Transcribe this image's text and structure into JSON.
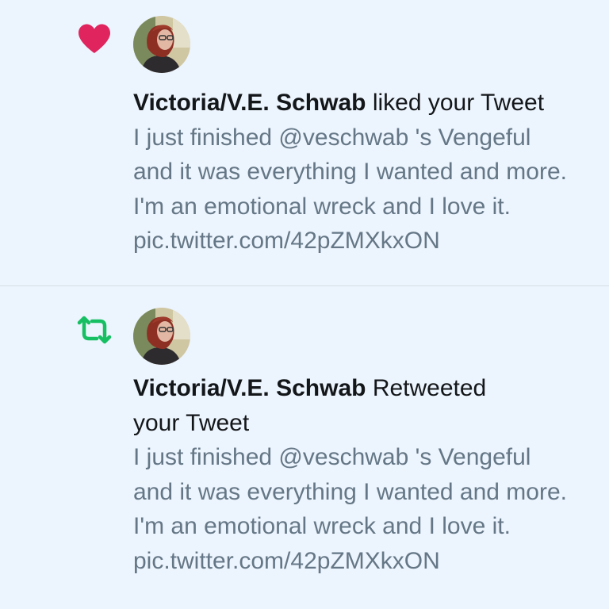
{
  "notifications": [
    {
      "type": "like",
      "icon": "heart-icon",
      "icon_color": "#e0245e",
      "user_name": "Victoria/V.E. Schwab",
      "action": "liked your Tweet",
      "tweet_text": "I just finished @veschwab 's Vengeful\nand it was everything I wanted and more.\nI'm an emotional wreck and I love it.\npic.twitter.com/42pZMXkxON"
    },
    {
      "type": "retweet",
      "icon": "retweet-icon",
      "icon_color": "#17bf63",
      "user_name": "Victoria/V.E. Schwab",
      "action": "Retweeted\nyour Tweet",
      "tweet_text": "I just finished @veschwab 's Vengeful\nand it was everything I wanted and more.\nI'm an emotional wreck and I love it.\npic.twitter.com/42pZMXkxON"
    }
  ]
}
